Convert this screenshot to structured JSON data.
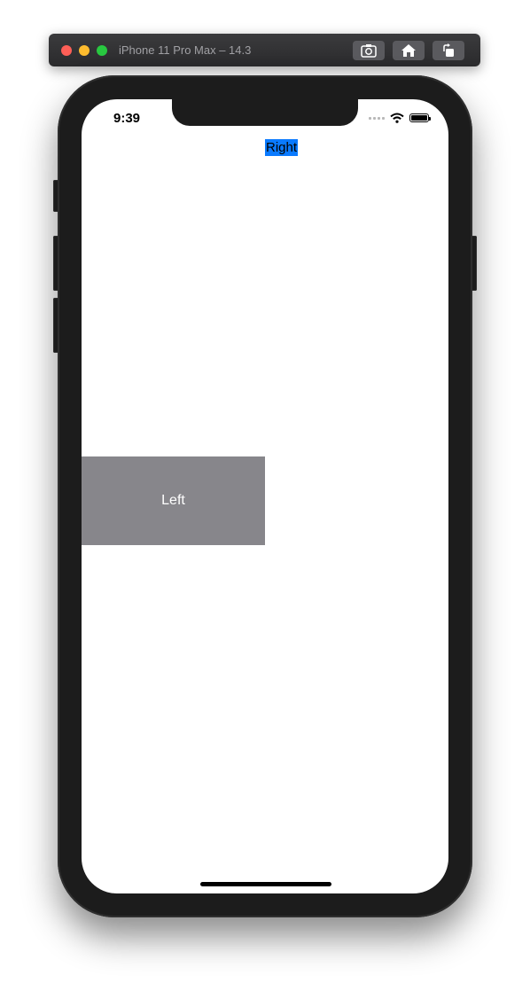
{
  "window": {
    "title": "iPhone 11 Pro Max – 14.3",
    "toolbar": [
      {
        "icon": "screenshot-icon"
      },
      {
        "icon": "home-icon"
      },
      {
        "icon": "rotate-icon"
      }
    ]
  },
  "status_bar": {
    "time": "9:39"
  },
  "app": {
    "right_label": "Right",
    "left_label": "Left"
  },
  "colors": {
    "right_label_bg": "#0a7aff",
    "left_view_bg": "#87868b"
  }
}
